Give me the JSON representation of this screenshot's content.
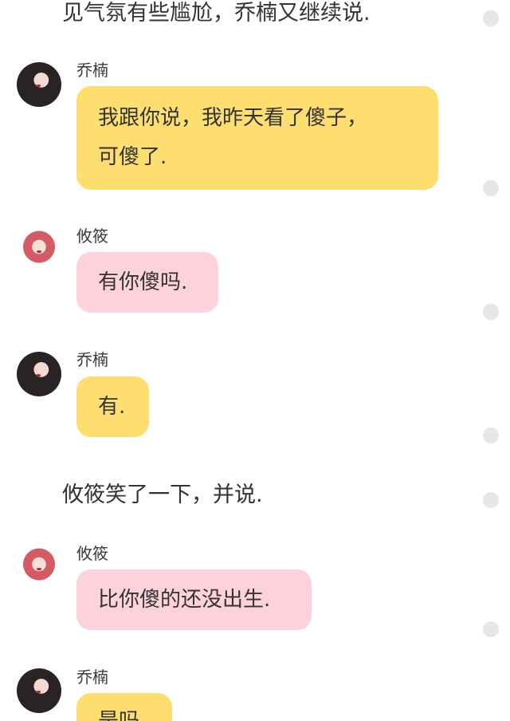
{
  "messages": [
    {
      "type": "narration",
      "text": "见气氛有些尴尬，乔楠又继续说."
    },
    {
      "type": "chat",
      "speaker": "乔楠",
      "avatar": "woman-dark-hair-avatar",
      "bubble_color": "#fede6e",
      "text": "我跟你说，我昨天看了傻子，可傻了."
    },
    {
      "type": "chat",
      "speaker": "攸筱",
      "avatar": "woman-pink-hair-avatar",
      "bubble_color": "#fdd2dc",
      "text": "有你傻吗."
    },
    {
      "type": "chat",
      "speaker": "乔楠",
      "avatar": "woman-dark-hair-avatar",
      "bubble_color": "#fede6e",
      "text": "有."
    },
    {
      "type": "narration",
      "text": "攸筱笑了一下，并说."
    },
    {
      "type": "chat",
      "speaker": "攸筱",
      "avatar": "woman-pink-hair-avatar",
      "bubble_color": "#fdd2dc",
      "text": "比你傻的还没出生."
    },
    {
      "type": "chat",
      "speaker": "乔楠",
      "avatar": "woman-dark-hair-avatar",
      "bubble_color": "#fede6e",
      "text": "是吗"
    }
  ],
  "colors": {
    "speaker_a_bubble": "#fede6e",
    "speaker_b_bubble": "#fdd2dc",
    "background": "#ffffff"
  }
}
